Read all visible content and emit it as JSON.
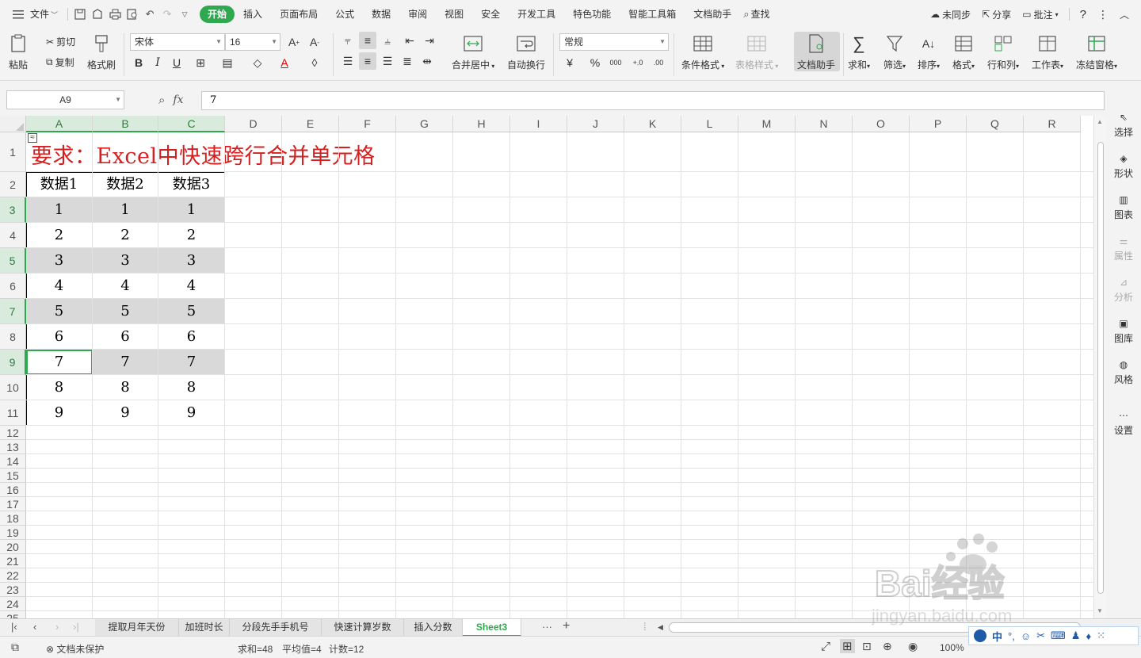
{
  "menubar": {
    "file_label": "文件",
    "tabs": [
      "开始",
      "插入",
      "页面布局",
      "公式",
      "数据",
      "审阅",
      "视图",
      "安全",
      "开发工具",
      "特色功能",
      "智能工具箱",
      "文档助手"
    ],
    "active_tab": "开始",
    "search_label": "查找",
    "sync_label": "未同步",
    "share_label": "分享",
    "annotate_label": "批注",
    "help_label": "?"
  },
  "ribbon": {
    "paste_label": "粘贴",
    "cut_label": "剪切",
    "copy_label": "复制",
    "format_painter_label": "格式刷",
    "font_name": "宋体",
    "font_size": "16",
    "merge_center_label": "合并居中",
    "wrap_text_label": "自动换行",
    "number_format": "常规",
    "conditional_format_label": "条件格式",
    "table_style_label": "表格样式",
    "doc_assistant_label": "文档助手",
    "sum_label": "求和",
    "filter_label": "筛选",
    "sort_label": "排序",
    "format_label": "格式",
    "rows_cols_label": "行和列",
    "worksheet_label": "工作表",
    "freeze_label": "冻结窗格"
  },
  "formula_bar": {
    "name_box": "A9",
    "fx_label": "fx",
    "formula_value": "7"
  },
  "sheet": {
    "columns": [
      "A",
      "B",
      "C",
      "D",
      "E",
      "F",
      "G",
      "H",
      "I",
      "J",
      "K",
      "L",
      "M",
      "N",
      "O",
      "P",
      "Q",
      "R"
    ],
    "selected_columns": [
      "A",
      "B",
      "C"
    ],
    "rows": [
      "1",
      "2",
      "3",
      "4",
      "5",
      "6",
      "7",
      "8",
      "9",
      "10",
      "11",
      "12",
      "13",
      "14",
      "15",
      "16",
      "17",
      "18",
      "19",
      "20",
      "21",
      "22",
      "23",
      "24",
      "25"
    ],
    "selected_rows": [
      "3",
      "5",
      "7",
      "9"
    ],
    "title": "要求：Excel中快速跨行合并单元格",
    "table_headers": [
      "数据1",
      "数据2",
      "数据3"
    ],
    "table_rows": [
      [
        "1",
        "1",
        "1"
      ],
      [
        "2",
        "2",
        "2"
      ],
      [
        "3",
        "3",
        "3"
      ],
      [
        "4",
        "4",
        "4"
      ],
      [
        "5",
        "5",
        "5"
      ],
      [
        "6",
        "6",
        "6"
      ],
      [
        "7",
        "7",
        "7"
      ],
      [
        "8",
        "8",
        "8"
      ],
      [
        "9",
        "9",
        "9"
      ]
    ],
    "corner_glyph": "≈"
  },
  "sidebar": {
    "items": [
      "选择",
      "形状",
      "图表",
      "属性",
      "分析",
      "图库",
      "风格",
      "设置"
    ],
    "disabled": [
      "属性",
      "分析"
    ]
  },
  "tabs": {
    "sheets": [
      "提取月年天份",
      "加班时长",
      "分段先手手机号",
      "快速计算岁数",
      "插入分数",
      "Sheet3"
    ],
    "active": "Sheet3",
    "more_label": "···",
    "add_label": "+"
  },
  "status": {
    "protection_label": "文档未保护",
    "sum_label": "求和=48",
    "avg_label": "平均值=4",
    "count_label": "计数=12",
    "zoom_label": "100%"
  },
  "watermark": {
    "brand_text": "Bai经验",
    "url_text": "jingyan.baidu.com"
  },
  "ime": {
    "mode_label": "中"
  },
  "colors": {
    "accent": "#2fa84f",
    "title_red": "#d42020",
    "highlight_gray": "#d9d9d9"
  }
}
